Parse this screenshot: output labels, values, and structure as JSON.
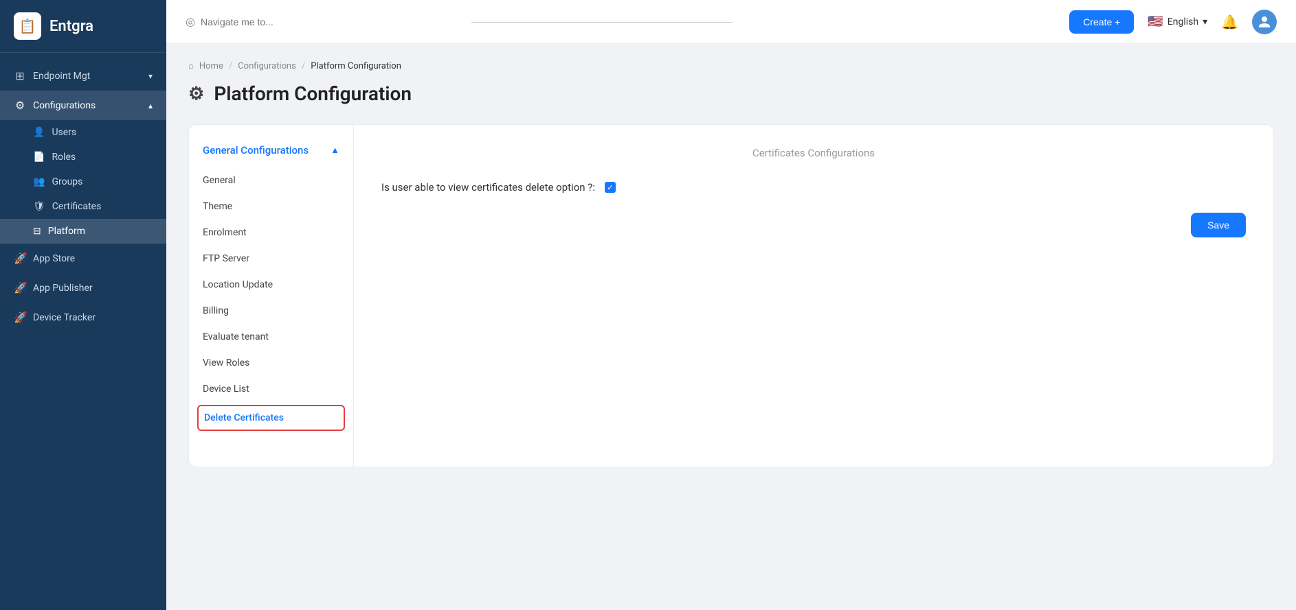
{
  "brand": {
    "name": "Entgra",
    "logo_char": "📋"
  },
  "topbar": {
    "search_placeholder": "Navigate me to...",
    "create_label": "Create +",
    "language": "English",
    "lang_dropdown_arrow": "▾"
  },
  "sidebar": {
    "nav_items": [
      {
        "id": "endpoint-mgt",
        "label": "Endpoint Mgt",
        "icon": "⊞",
        "has_arrow": true,
        "expanded": false
      },
      {
        "id": "configurations",
        "label": "Configurations",
        "icon": "⚙",
        "has_arrow": true,
        "expanded": true
      },
      {
        "id": "users",
        "label": "Users",
        "icon": "👤",
        "sub": true
      },
      {
        "id": "roles",
        "label": "Roles",
        "icon": "📄",
        "sub": true
      },
      {
        "id": "groups",
        "label": "Groups",
        "icon": "👥",
        "sub": true
      },
      {
        "id": "certificates",
        "label": "Certificates",
        "icon": "🛡",
        "sub": true
      },
      {
        "id": "platform",
        "label": "Platform",
        "icon": "⊟",
        "sub": true,
        "active": true
      },
      {
        "id": "app-store",
        "label": "App Store",
        "icon": "🚀",
        "sub": false
      },
      {
        "id": "app-publisher",
        "label": "App Publisher",
        "icon": "🚀",
        "sub": false
      },
      {
        "id": "device-tracker",
        "label": "Device Tracker",
        "icon": "🚀",
        "sub": false
      }
    ]
  },
  "breadcrumb": {
    "home": "Home",
    "configurations": "Configurations",
    "current": "Platform Configuration"
  },
  "page": {
    "title": "Platform Configuration",
    "title_icon": "⚙"
  },
  "card_sidebar": {
    "section_label": "General Configurations",
    "chevron": "▲",
    "menu_items": [
      {
        "id": "general",
        "label": "General"
      },
      {
        "id": "theme",
        "label": "Theme"
      },
      {
        "id": "enrolment",
        "label": "Enrolment"
      },
      {
        "id": "ftp-server",
        "label": "FTP Server"
      },
      {
        "id": "location-update",
        "label": "Location Update"
      },
      {
        "id": "billing",
        "label": "Billing"
      },
      {
        "id": "evaluate-tenant",
        "label": "Evaluate tenant"
      },
      {
        "id": "view-roles",
        "label": "View Roles"
      },
      {
        "id": "device-list",
        "label": "Device List"
      },
      {
        "id": "delete-certificates",
        "label": "Delete Certificates",
        "active_cert": true
      }
    ]
  },
  "card_main": {
    "section_title": "Certificates Configurations",
    "cert_option_label": "Is user able to view certificates delete option ?:",
    "cert_checked": true,
    "save_label": "Save"
  }
}
